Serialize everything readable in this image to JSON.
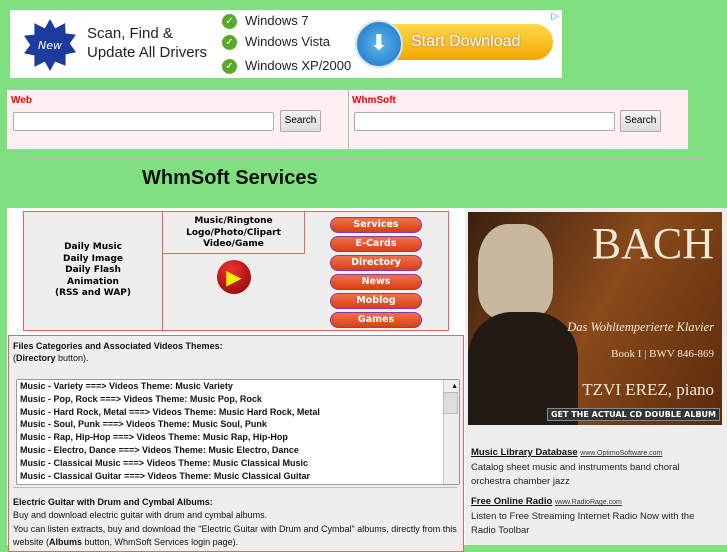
{
  "top_ad": {
    "badge": "New",
    "headline": "Scan, Find & Update All Drivers",
    "checks": [
      "Windows 7",
      "Windows Vista",
      "Windows XP/2000"
    ],
    "cta": "Start Download"
  },
  "search": {
    "web_label": "Web",
    "whmsoft_label": "WhmSoft",
    "button": "Search",
    "web_value": "",
    "whmsoft_value": ""
  },
  "page_title": "WhmSoft Services",
  "services": {
    "daily": [
      "Daily Music",
      "Daily Image",
      "Daily Flash",
      "Animation",
      "(RSS and WAP)"
    ],
    "types": [
      "Music/Ringtone",
      "Logo/Photo/Clipart",
      "Video/Game"
    ],
    "buttons": [
      "Services",
      "E-Cards",
      "Directory",
      "News",
      "Moblog",
      "Games"
    ]
  },
  "files": {
    "heading": "Files Categories and Associated Videos Themes:",
    "note_bold": "Directory",
    "note_rest": " button).",
    "note_open": "(",
    "items": [
      "Music - Variety ===> Videos Theme: Music Variety",
      "Music - Pop, Rock ===> Videos Theme: Music Pop, Rock",
      "Music - Hard Rock, Metal ===> Videos Theme: Music Hard Rock, Metal",
      "Music - Soul, Punk ===> Videos Theme: Music Soul, Punk",
      "Music - Rap, Hip-Hop ===> Videos Theme: Music Rap, Hip-Hop",
      "Music - Electro, Dance ===> Videos Theme: Music Electro, Dance",
      "Music - Classical Music ===> Videos Theme: Music Classical Music",
      "Music - Classical Guitar ===> Videos Theme: Music Classical Guitar"
    ],
    "album_heading": "Electric Guitar with Drum and Cymbal Albums:",
    "album_line1": "Buy and download electric guitar with drum and cymbal albums.",
    "album_line2": "You can listen extracts, buy and download the \"Electric Guitar with Drum and Cymbal\" albums, directly from this website (",
    "album_bold": "Albums",
    "album_line2_end": " button, WhmSoft Services login page)."
  },
  "side_ad": {
    "title": "BACH",
    "subtitle": "Das Wohltemperierte Klavier",
    "book": "Book I | BWV 846-869",
    "artist": "TZVI EREZ, piano",
    "cta": "GET THE ACTUAL CD DOUBLE ALBUM"
  },
  "text_ads": [
    {
      "title": "Music Library Database",
      "url": "www.OptimoSoftware.com",
      "desc": "Catalog sheet music and instruments band choral orchestra chamber jazz"
    },
    {
      "title": "Free Online Radio",
      "url": "www.RadioRage.com",
      "desc": "Listen to Free Streaming Internet Radio Now with the Radio Toolbar"
    }
  ]
}
